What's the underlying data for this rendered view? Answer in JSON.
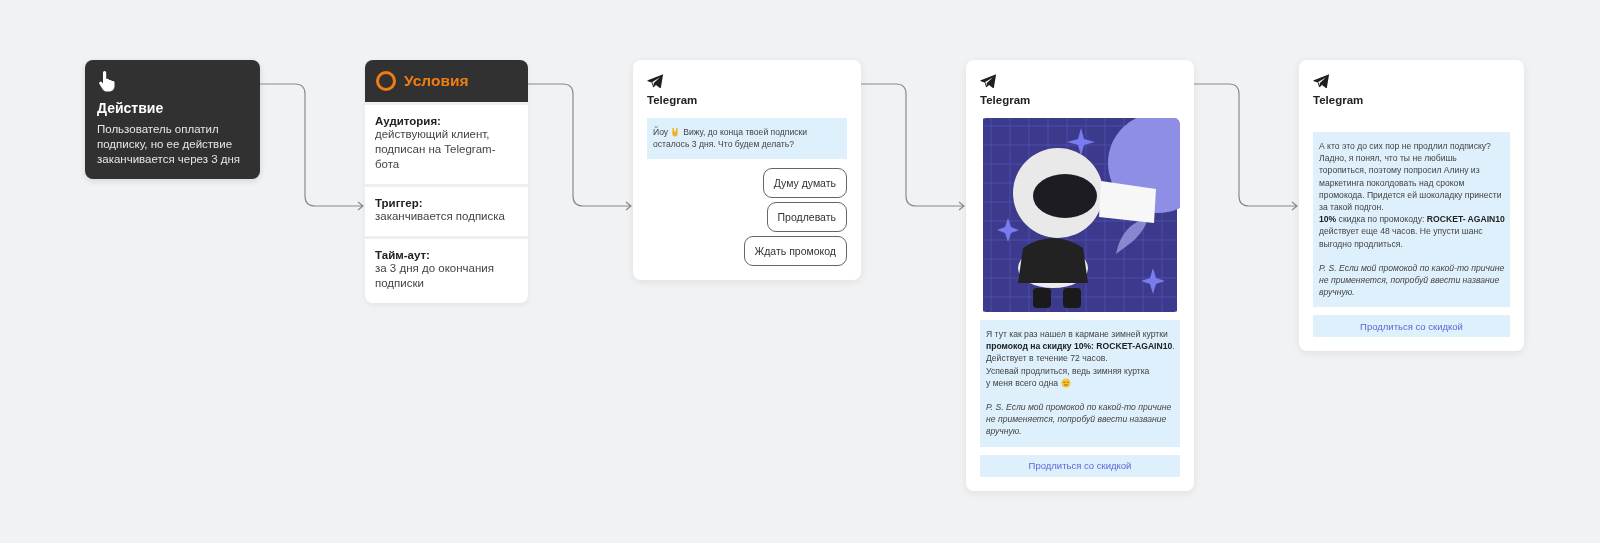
{
  "action": {
    "title": "Действие",
    "text": "Пользователь оплатил подписку, но ее действие заканчивается через 3 дня"
  },
  "conditions": {
    "title": "Условия",
    "sections": [
      {
        "label": "Аудитория:",
        "value": "действующий клиент, подписан на Telegram-бота"
      },
      {
        "label": "Триггер:",
        "value": "заканчивается подписка"
      },
      {
        "label": "Тайм-аут:",
        "value": "за 3 дня до окончания подписки"
      }
    ]
  },
  "messages": [
    {
      "app": "Telegram",
      "blocks": [
        {
          "kind": "bubble",
          "paragraphs": [
            {
              "kind": "body",
              "lines": [
                [
                  {
                    "kind": "text",
                    "text": "Йоу"
                  },
                  {
                    "kind": "hand-sign"
                  },
                  {
                    "kind": "text",
                    "text": "Вижу, до конца твоей подписки"
                  }
                ],
                [
                  {
                    "kind": "text",
                    "text": "осталось 3 дня. Что будем делать?"
                  }
                ]
              ]
            }
          ]
        },
        {
          "kind": "reply",
          "label": "Думу думать"
        },
        {
          "kind": "reply",
          "label": "Продлевать"
        },
        {
          "kind": "reply",
          "label": "Ждать промокод"
        }
      ]
    },
    {
      "app": "Telegram",
      "blocks": [
        {
          "kind": "picture"
        },
        {
          "kind": "bubble",
          "paragraphs": [
            {
              "kind": "body",
              "lines": [
                [
                  {
                    "kind": "text",
                    "text": "Я тут как раз нашел в кармане зимней куртки"
                  }
                ],
                [
                  {
                    "kind": "text",
                    "text": "**промокод на скидку 10%: ROCKET-AGAIN10**."
                  }
                ],
                [
                  {
                    "kind": "text",
                    "text": "Действует в течение 72 часов."
                  }
                ],
                [
                  {
                    "kind": "text",
                    "text": "Успевай продлиться, ведь зимняя куртка"
                  }
                ],
                [
                  {
                    "kind": "text",
                    "text": "у меня всего одна"
                  },
                  {
                    "kind": "face"
                  }
                ]
              ]
            },
            {
              "kind": "postscript",
              "lines": [
                [
                  {
                    "kind": "text",
                    "text": "P. S. Если мой промокод по какой-то причине"
                  }
                ],
                [
                  {
                    "kind": "text",
                    "text": "не применяется, попробуй ввести название"
                  }
                ],
                [
                  {
                    "kind": "text",
                    "text": "вручную."
                  }
                ]
              ]
            }
          ]
        },
        {
          "kind": "link_button",
          "label": "Продлиться со скидкой"
        }
      ]
    },
    {
      "app": "Telegram",
      "blocks": [
        {
          "kind": "bubble",
          "paragraphs": [
            {
              "kind": "body",
              "lines": [
                [
                  {
                    "kind": "text",
                    "text": "А кто это до сих пор не продлил подписку?"
                  }
                ],
                [
                  {
                    "kind": "text",
                    "text": "Ладно, я понял, что ты не любишь"
                  }
                ],
                [
                  {
                    "kind": "text",
                    "text": "торопиться, поэтому попросил Алину из"
                  }
                ],
                [
                  {
                    "kind": "text",
                    "text": "маркетинга поколдовать над сроком"
                  }
                ],
                [
                  {
                    "kind": "text",
                    "text": "промокода. Придется ей шоколадку принести"
                  }
                ],
                [
                  {
                    "kind": "text",
                    "text": "за такой подгон."
                  }
                ],
                [
                  {
                    "kind": "text",
                    "text": "**10%** скидка по промокоду: **ROCKET- AGAIN10**"
                  }
                ],
                [
                  {
                    "kind": "text",
                    "text": "действует еще 48 часов. Не упусти шанс"
                  }
                ],
                [
                  {
                    "kind": "text",
                    "text": "выгодно продлиться."
                  }
                ]
              ]
            },
            {
              "kind": "postscript",
              "lines": [
                [
                  {
                    "kind": "text",
                    "text": "P. S. Если мой промокод по какой-то причине"
                  }
                ],
                [
                  {
                    "kind": "text",
                    "text": "не применяется, попробуй ввести название"
                  }
                ],
                [
                  {
                    "kind": "text",
                    "text": "вручную."
                  }
                ]
              ]
            }
          ]
        },
        {
          "kind": "link_button",
          "label": "Продлиться со скидкой"
        }
      ]
    }
  ]
}
